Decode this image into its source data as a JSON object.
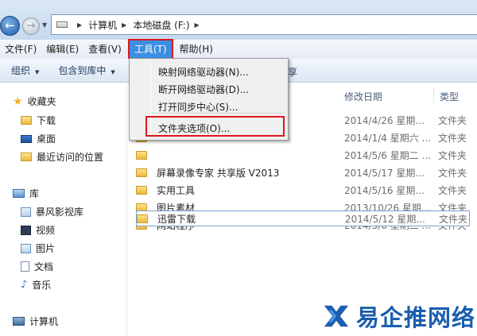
{
  "address_bar": {
    "crumbs": [
      "计算机",
      "本地磁盘 (F:)"
    ]
  },
  "menubar": {
    "items": [
      "文件(F)",
      "编辑(E)",
      "查看(V)",
      "工具(T)",
      "帮助(H)"
    ]
  },
  "commandbar": {
    "items": [
      "组织",
      "包含到库中"
    ],
    "partial_text": "享"
  },
  "tools_menu": {
    "items": [
      "映射网络驱动器(N)...",
      "断开网络驱动器(D)...",
      "打开同步中心(S)...",
      "文件夹选项(O)..."
    ]
  },
  "navigation": {
    "favorites_label": "收藏夹",
    "favorites": [
      "下载",
      "桌面",
      "最近访问的位置"
    ],
    "libraries_label": "库",
    "libraries": [
      "暴风影视库",
      "视频",
      "图片",
      "文档",
      "音乐"
    ],
    "computer_label": "计算机"
  },
  "file_list": {
    "columns": [
      "修改日期",
      "类型"
    ],
    "rows": [
      {
        "name": "",
        "date": "2014/4/26 星期...",
        "type": "文件夹"
      },
      {
        "name": "",
        "date": "2014/1/4 星期六 ...",
        "type": "文件夹"
      },
      {
        "name": "",
        "date": "2014/5/6 星期二 ...",
        "type": "文件夹"
      },
      {
        "name": "屏幕录像专家 共享版 V2013",
        "date": "2014/5/17 星期...",
        "type": "文件夹"
      },
      {
        "name": "实用工具",
        "date": "2014/5/16 星期...",
        "type": "文件夹"
      },
      {
        "name": "图片素材",
        "date": "2013/10/26 星期...",
        "type": "文件夹"
      },
      {
        "name": "网站程序",
        "date": "2014/5/6 星期二 ...",
        "type": "文件夹"
      },
      {
        "name": "迅雷下载",
        "date": "2014/5/12 星期...",
        "type": "文件夹"
      }
    ]
  },
  "watermark": {
    "text": "易企推网络"
  },
  "colors": {
    "highlight_red": "#e0161c",
    "menu_active_blue": "#3a8ee3",
    "watermark_blue": "#1a5fae"
  }
}
